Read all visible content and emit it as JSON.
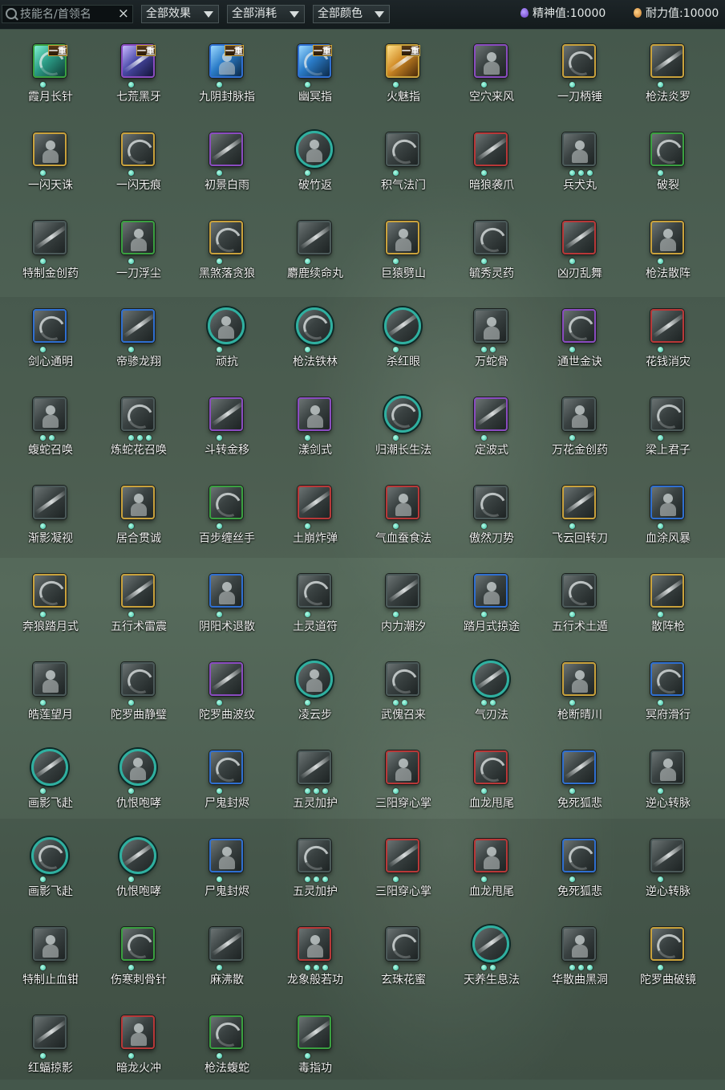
{
  "toolbar": {
    "search_placeholder": "技能名/首领名",
    "clear_icon": "×",
    "effect_filter": "全部效果",
    "cost_filter": "全部消耗",
    "color_filter": "全部颜色",
    "spirit_label": "精神值:",
    "spirit_value": "10000",
    "stamina_label": "耐力值:",
    "stamina_value": "10000"
  },
  "skills": [
    {
      "name": "霞月长针",
      "frame": "green",
      "art": "hl-teal",
      "tier": "一重",
      "dots": 1
    },
    {
      "name": "七荒黑牙",
      "frame": "purple",
      "art": "hl-violet",
      "tier": "一重",
      "dots": 1
    },
    {
      "name": "九阴封脉指",
      "frame": "blue",
      "art": "hl-blue",
      "tier": "一重",
      "dots": 1
    },
    {
      "name": "幽冥指",
      "frame": "blue",
      "art": "hl-blue",
      "tier": "一重",
      "dots": 1
    },
    {
      "name": "火魅指",
      "frame": "gold",
      "art": "hl-gold",
      "tier": "一重",
      "dots": 1
    },
    {
      "name": "空穴来风",
      "frame": "purple",
      "art": "",
      "tier": "",
      "dots": 1
    },
    {
      "name": "一刀柄锤",
      "frame": "gold",
      "art": "",
      "tier": "",
      "dots": 1
    },
    {
      "name": "枪法炎罗",
      "frame": "gold",
      "art": "",
      "tier": "",
      "dots": 1
    },
    {
      "name": "一闪天诛",
      "frame": "gold",
      "art": "",
      "tier": "",
      "dots": 1
    },
    {
      "name": "一闪无痕",
      "frame": "gold",
      "art": "",
      "tier": "",
      "dots": 1
    },
    {
      "name": "初景白雨",
      "frame": "purple",
      "art": "",
      "tier": "",
      "dots": 1
    },
    {
      "name": "破竹返",
      "frame": "circle",
      "art": "",
      "tier": "",
      "dots": 1
    },
    {
      "name": "积气法门",
      "frame": "gray",
      "art": "",
      "tier": "",
      "dots": 1
    },
    {
      "name": "暗狼袭爪",
      "frame": "red",
      "art": "",
      "tier": "",
      "dots": 1
    },
    {
      "name": "兵犬丸",
      "frame": "gray",
      "art": "",
      "tier": "",
      "dots": 3
    },
    {
      "name": "破裂",
      "frame": "green",
      "art": "",
      "tier": "",
      "dots": 1
    },
    {
      "name": "特制金创药",
      "frame": "gray",
      "art": "",
      "tier": "",
      "dots": 1
    },
    {
      "name": "一刀浮尘",
      "frame": "green",
      "art": "",
      "tier": "",
      "dots": 1
    },
    {
      "name": "黑煞落贪狼",
      "frame": "gold",
      "art": "",
      "tier": "",
      "dots": 1
    },
    {
      "name": "麝鹿续命丸",
      "frame": "gray",
      "art": "",
      "tier": "",
      "dots": 1
    },
    {
      "name": "巨猿劈山",
      "frame": "gold",
      "art": "",
      "tier": "",
      "dots": 1
    },
    {
      "name": "毓秀灵药",
      "frame": "gray",
      "art": "",
      "tier": "",
      "dots": 1
    },
    {
      "name": "凶刃乱舞",
      "frame": "red",
      "art": "",
      "tier": "",
      "dots": 1
    },
    {
      "name": "枪法散阵",
      "frame": "gold",
      "art": "",
      "tier": "",
      "dots": 1
    },
    {
      "name": "剑心通明",
      "frame": "blue",
      "art": "",
      "tier": "",
      "dots": 1
    },
    {
      "name": "帝骖龙翔",
      "frame": "blue",
      "art": "",
      "tier": "",
      "dots": 1
    },
    {
      "name": "顽抗",
      "frame": "circle",
      "art": "",
      "tier": "",
      "dots": 1
    },
    {
      "name": "枪法铁林",
      "frame": "circle",
      "art": "",
      "tier": "",
      "dots": 1
    },
    {
      "name": "杀红眼",
      "frame": "circle",
      "art": "",
      "tier": "",
      "dots": 1
    },
    {
      "name": "万蛇骨",
      "frame": "gray",
      "art": "",
      "tier": "",
      "dots": 2
    },
    {
      "name": "通世金诀",
      "frame": "purple",
      "art": "",
      "tier": "",
      "dots": 1
    },
    {
      "name": "花钱消灾",
      "frame": "red",
      "art": "",
      "tier": "",
      "dots": 1
    },
    {
      "name": "蝮蛇召唤",
      "frame": "gray",
      "art": "",
      "tier": "",
      "dots": 2
    },
    {
      "name": "炼蛇花召唤",
      "frame": "gray",
      "art": "",
      "tier": "",
      "dots": 3
    },
    {
      "name": "斗转金移",
      "frame": "purple",
      "art": "",
      "tier": "",
      "dots": 1
    },
    {
      "name": "漾剑式",
      "frame": "purple",
      "art": "",
      "tier": "",
      "dots": 1
    },
    {
      "name": "归潮长生法",
      "frame": "circle",
      "art": "",
      "tier": "",
      "dots": 1
    },
    {
      "name": "定波式",
      "frame": "purple",
      "art": "",
      "tier": "",
      "dots": 1
    },
    {
      "name": "万花金创药",
      "frame": "gray",
      "art": "",
      "tier": "",
      "dots": 1
    },
    {
      "name": "梁上君子",
      "frame": "gray",
      "art": "",
      "tier": "",
      "dots": 1
    },
    {
      "name": "渐影凝视",
      "frame": "gray",
      "art": "",
      "tier": "",
      "dots": 1
    },
    {
      "name": "居合贯诚",
      "frame": "gold",
      "art": "",
      "tier": "",
      "dots": 1
    },
    {
      "name": "百步缠丝手",
      "frame": "green",
      "art": "",
      "tier": "",
      "dots": 1
    },
    {
      "name": "土崩炸弹",
      "frame": "red",
      "art": "",
      "tier": "",
      "dots": 1
    },
    {
      "name": "气血蚕食法",
      "frame": "red",
      "art": "",
      "tier": "",
      "dots": 1
    },
    {
      "name": "傲然刀势",
      "frame": "gray",
      "art": "",
      "tier": "",
      "dots": 1
    },
    {
      "name": "飞云回转刀",
      "frame": "gold",
      "art": "",
      "tier": "",
      "dots": 1
    },
    {
      "name": "血涂风暴",
      "frame": "blue",
      "art": "",
      "tier": "",
      "dots": 1
    },
    {
      "name": "奔狼踏月式",
      "frame": "gold",
      "art": "",
      "tier": "",
      "dots": 1
    },
    {
      "name": "五行术雷震",
      "frame": "gold",
      "art": "",
      "tier": "",
      "dots": 1
    },
    {
      "name": "阴阳术退散",
      "frame": "blue",
      "art": "",
      "tier": "",
      "dots": 1
    },
    {
      "name": "土灵道符",
      "frame": "gray",
      "art": "",
      "tier": "",
      "dots": 1
    },
    {
      "name": "内力潮汐",
      "frame": "gray",
      "art": "",
      "tier": "",
      "dots": 1
    },
    {
      "name": "踏月式掠途",
      "frame": "blue",
      "art": "",
      "tier": "",
      "dots": 1
    },
    {
      "name": "五行术土遁",
      "frame": "gray",
      "art": "",
      "tier": "",
      "dots": 1
    },
    {
      "name": "散阵枪",
      "frame": "gold",
      "art": "",
      "tier": "",
      "dots": 1
    },
    {
      "name": "皓莲望月",
      "frame": "gray",
      "art": "",
      "tier": "",
      "dots": 1
    },
    {
      "name": "陀罗曲静璧",
      "frame": "gray",
      "art": "",
      "tier": "",
      "dots": 1
    },
    {
      "name": "陀罗曲波纹",
      "frame": "purple",
      "art": "",
      "tier": "",
      "dots": 1
    },
    {
      "name": "凌云步",
      "frame": "circle",
      "art": "",
      "tier": "",
      "dots": 1
    },
    {
      "name": "武傀召来",
      "frame": "gray",
      "art": "",
      "tier": "",
      "dots": 2
    },
    {
      "name": "气刃法",
      "frame": "circle",
      "art": "",
      "tier": "",
      "dots": 2
    },
    {
      "name": "枪断晴川",
      "frame": "gold",
      "art": "",
      "tier": "",
      "dots": 1
    },
    {
      "name": "冥府滑行",
      "frame": "blue",
      "art": "",
      "tier": "",
      "dots": 1
    },
    {
      "name": "画影飞赴",
      "frame": "circle",
      "art": "",
      "tier": "",
      "dots": 1
    },
    {
      "name": "仇恨咆哮",
      "frame": "circle",
      "art": "",
      "tier": "",
      "dots": 1
    },
    {
      "name": "尸鬼封烬",
      "frame": "blue",
      "art": "",
      "tier": "",
      "dots": 1
    },
    {
      "name": "五灵加护",
      "frame": "gray",
      "art": "",
      "tier": "",
      "dots": 3
    },
    {
      "name": "三阳穿心掌",
      "frame": "red",
      "art": "",
      "tier": "",
      "dots": 1
    },
    {
      "name": "血龙甩尾",
      "frame": "red",
      "art": "",
      "tier": "",
      "dots": 1
    },
    {
      "name": "免死狐悲",
      "frame": "blue",
      "art": "",
      "tier": "",
      "dots": 1
    },
    {
      "name": "逆心转脉",
      "frame": "gray",
      "art": "",
      "tier": "",
      "dots": 1
    },
    {
      "name": "画影飞赴",
      "frame": "circle",
      "art": "",
      "tier": "",
      "dots": 1
    },
    {
      "name": "仇恨咆哮",
      "frame": "circle",
      "art": "",
      "tier": "",
      "dots": 1
    },
    {
      "name": "尸鬼封烬",
      "frame": "blue",
      "art": "",
      "tier": "",
      "dots": 1
    },
    {
      "name": "五灵加护",
      "frame": "gray",
      "art": "",
      "tier": "",
      "dots": 3
    },
    {
      "name": "三阳穿心掌",
      "frame": "red",
      "art": "",
      "tier": "",
      "dots": 1
    },
    {
      "name": "血龙甩尾",
      "frame": "red",
      "art": "",
      "tier": "",
      "dots": 1
    },
    {
      "name": "免死狐悲",
      "frame": "blue",
      "art": "",
      "tier": "",
      "dots": 1
    },
    {
      "name": "逆心转脉",
      "frame": "gray",
      "art": "",
      "tier": "",
      "dots": 1
    },
    {
      "name": "特制止血钳",
      "frame": "gray",
      "art": "",
      "tier": "",
      "dots": 1
    },
    {
      "name": "伤寒刺骨针",
      "frame": "green",
      "art": "",
      "tier": "",
      "dots": 1
    },
    {
      "name": "麻沸散",
      "frame": "gray",
      "art": "",
      "tier": "",
      "dots": 1
    },
    {
      "name": "龙象般若功",
      "frame": "red",
      "art": "",
      "tier": "",
      "dots": 3
    },
    {
      "name": "玄珠花蜜",
      "frame": "gray",
      "art": "",
      "tier": "",
      "dots": 1
    },
    {
      "name": "天养生息法",
      "frame": "circle",
      "art": "",
      "tier": "",
      "dots": 2
    },
    {
      "name": "华散曲黑洞",
      "frame": "gray",
      "art": "",
      "tier": "",
      "dots": 3
    },
    {
      "name": "陀罗曲破镜",
      "frame": "gold",
      "art": "",
      "tier": "",
      "dots": 1
    },
    {
      "name": "红蝠掠影",
      "frame": "gray",
      "art": "",
      "tier": "",
      "dots": 1
    },
    {
      "name": "暗龙火冲",
      "frame": "red",
      "art": "",
      "tier": "",
      "dots": 1
    },
    {
      "name": "枪法蝮蛇",
      "frame": "green",
      "art": "",
      "tier": "",
      "dots": 1
    },
    {
      "name": "毒指功",
      "frame": "green",
      "art": "",
      "tier": "",
      "dots": 1
    }
  ]
}
